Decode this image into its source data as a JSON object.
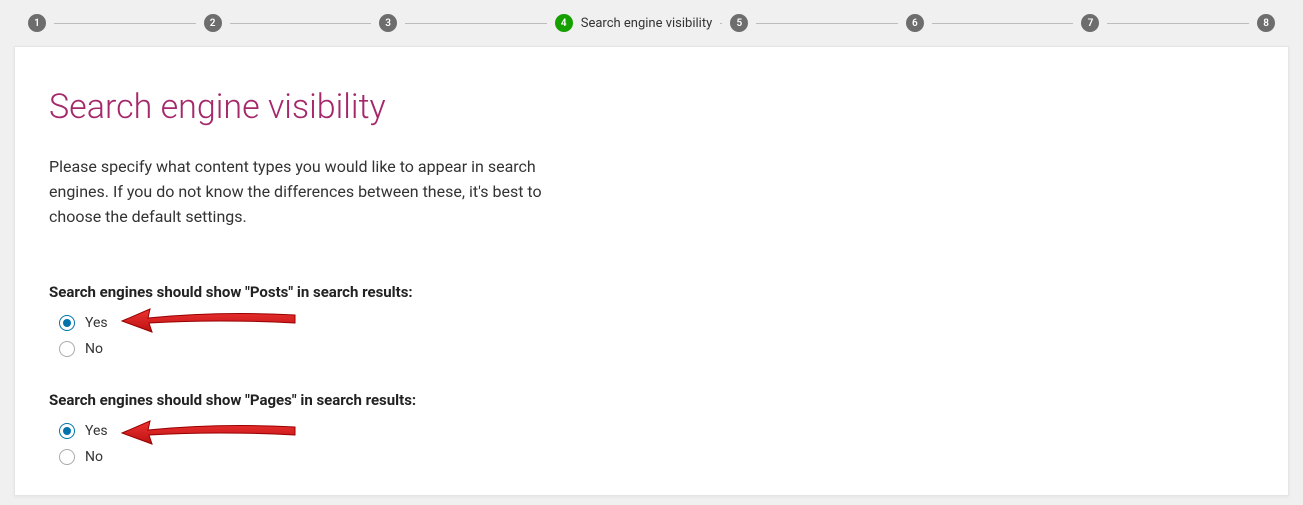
{
  "stepper": {
    "steps": [
      "1",
      "2",
      "3",
      "4",
      "5",
      "6",
      "7",
      "8"
    ],
    "activeIndex": 3,
    "activeLabel": "Search engine visibility"
  },
  "page": {
    "title": "Search engine visibility",
    "intro": "Please specify what content types you would like to appear in search engines. If you do not know the differences between these, it's best to choose the default settings."
  },
  "groups": {
    "posts": {
      "label": "Search engines should show \"Posts\" in search results:",
      "yes": "Yes",
      "no": "No",
      "selected": "yes"
    },
    "pages": {
      "label": "Search engines should show \"Pages\" in search results:",
      "yes": "Yes",
      "no": "No",
      "selected": "yes"
    }
  }
}
